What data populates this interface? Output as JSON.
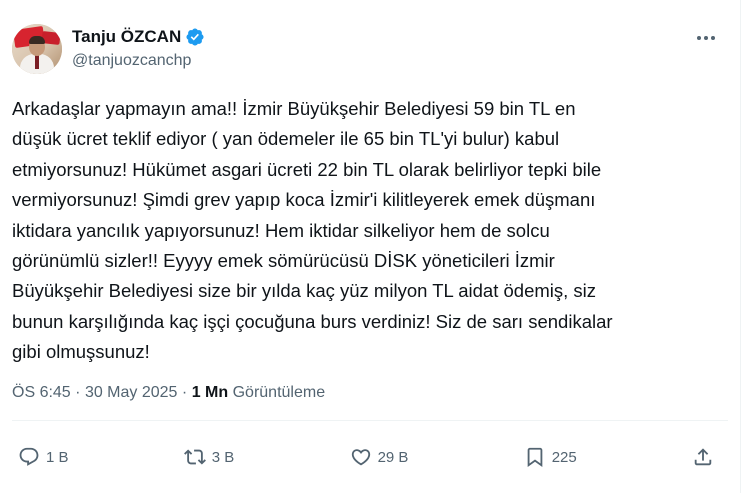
{
  "author": {
    "name": "Tanju ÖZCAN",
    "handle": "@tanjuozcanchp",
    "verified": true
  },
  "tweet": {
    "text": "Arkadaşlar yapmayın ama!! İzmir Büyükşehir Belediyesi 59 bin TL en\ndüşük ücret teklif ediyor ( yan ödemeler ile 65 bin TL'yi bulur) kabul\netmiyorsunuz! Hükümet asgari ücreti 22 bin TL olarak belirliyor tepki bile\nvermiyorsunuz! Şimdi grev yapıp koca İzmir'i kilitleyerek emek düşmanı\niktidara yancılık yapıyorsunuz! Hem iktidar silkeliyor hem de solcu\ngörünümlü sizler!! Eyyyy emek sömürücüsü DİSK yöneticileri İzmir\nBüyükşehir Belediyesi size bir yılda kaç yüz milyon TL aidat ödemiş, siz\nbunun karşılığında kaç işçi çocuğuna burs verdiniz! Siz de sarı sendikalar\ngibi olmuşsunuz!"
  },
  "meta": {
    "time": "ÖS 6:45",
    "separator": "·",
    "date": "30 May 2025",
    "views_count": "1 Mn",
    "views_label": "Görüntüleme"
  },
  "actions": {
    "replies": "1 B",
    "reposts": "3 B",
    "likes": "29 B",
    "bookmarks": "225"
  },
  "colors": {
    "verified": "#1d9bf0",
    "secondary_text": "#536471",
    "primary_text": "#0f1419",
    "divider": "#eff3f4"
  },
  "icons": {
    "verified": "verified-badge-icon",
    "more": "more-horizontal-icon",
    "reply": "reply-bubble-icon",
    "repost": "repost-arrows-icon",
    "like": "heart-icon",
    "bookmark": "bookmark-icon",
    "share": "share-upload-icon"
  }
}
